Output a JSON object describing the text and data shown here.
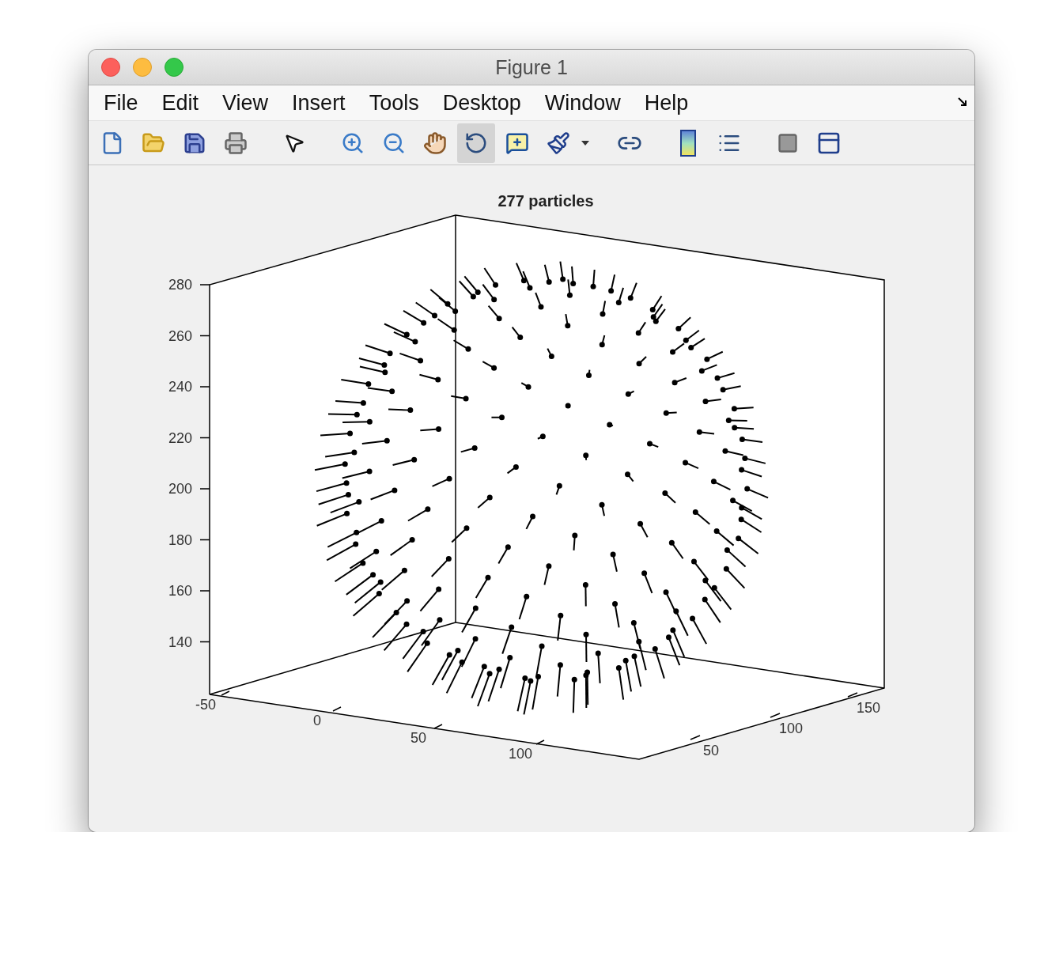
{
  "window": {
    "title": "Figure 1"
  },
  "menu": [
    "File",
    "Edit",
    "View",
    "Insert",
    "Tools",
    "Desktop",
    "Window",
    "Help"
  ],
  "toolbar": {
    "groups": [
      [
        {
          "pressed": false
        },
        {
          "pressed": false
        },
        {
          "pressed": false
        },
        {
          "pressed": false
        }
      ],
      [
        {
          "pressed": false
        }
      ],
      [
        {
          "pressed": false
        },
        {
          "pressed": false
        },
        {
          "pressed": false
        },
        {
          "pressed": true
        },
        {
          "pressed": false
        },
        {
          "pressed": false
        }
      ],
      [
        {
          "pressed": false
        }
      ],
      [
        {
          "pressed": false
        },
        {
          "pressed": false
        }
      ],
      [
        {
          "pressed": false
        },
        {
          "pressed": false
        }
      ]
    ]
  },
  "plot": {
    "title": "277 particles",
    "z_ticks": [
      "280",
      "260",
      "240",
      "220",
      "200",
      "180",
      "160",
      "140"
    ],
    "x_ticks": [
      "-50",
      "0",
      "50",
      "100"
    ],
    "y_ticks": [
      "50",
      "100",
      "150"
    ]
  }
}
